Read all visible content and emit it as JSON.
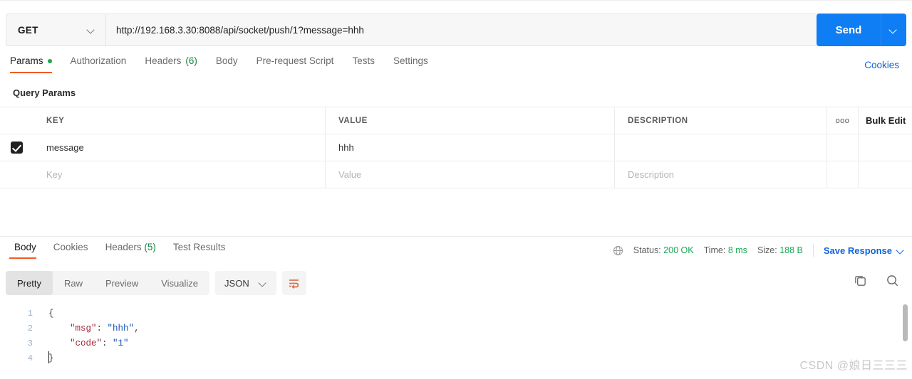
{
  "request": {
    "method": "GET",
    "url": "http://192.168.3.30:8088/api/socket/push/1?message=hhh",
    "send_label": "Send",
    "cookies_label": "Cookies",
    "tabs": [
      {
        "label": "Params",
        "dot": true,
        "active": true
      },
      {
        "label": "Authorization",
        "active": false
      },
      {
        "label": "Headers",
        "count": "(6)",
        "active": false
      },
      {
        "label": "Body",
        "active": false
      },
      {
        "label": "Pre-request Script",
        "active": false
      },
      {
        "label": "Tests",
        "active": false
      },
      {
        "label": "Settings",
        "active": false
      }
    ]
  },
  "query_params": {
    "section_title": "Query Params",
    "columns": [
      "KEY",
      "VALUE",
      "DESCRIPTION"
    ],
    "bulk_edit_label": "Bulk Edit",
    "more_icon": "ooo",
    "rows": [
      {
        "checked": true,
        "key": "message",
        "value": "hhh",
        "description": ""
      }
    ],
    "placeholder_row": {
      "key": "Key",
      "value": "Value",
      "description": "Description"
    }
  },
  "response": {
    "tabs": [
      {
        "label": "Body",
        "active": true
      },
      {
        "label": "Cookies",
        "active": false
      },
      {
        "label": "Headers",
        "count": "(5)",
        "active": false
      },
      {
        "label": "Test Results",
        "active": false
      }
    ],
    "status_label": "Status:",
    "status_value": "200 OK",
    "time_label": "Time:",
    "time_value": "8 ms",
    "size_label": "Size:",
    "size_value": "188 B",
    "save_response_label": "Save Response",
    "view_modes": [
      {
        "label": "Pretty",
        "active": true
      },
      {
        "label": "Raw",
        "active": false
      },
      {
        "label": "Preview",
        "active": false
      },
      {
        "label": "Visualize",
        "active": false
      }
    ],
    "format": "JSON",
    "body_lines": [
      {
        "n": "1",
        "tokens": [
          {
            "t": "{",
            "c": "p"
          }
        ]
      },
      {
        "n": "2",
        "tokens": [
          {
            "t": "    ",
            "c": "p"
          },
          {
            "t": "\"msg\"",
            "c": "k"
          },
          {
            "t": ": ",
            "c": "p"
          },
          {
            "t": "\"hhh\"",
            "c": "s"
          },
          {
            "t": ",",
            "c": "p"
          }
        ]
      },
      {
        "n": "3",
        "tokens": [
          {
            "t": "    ",
            "c": "p"
          },
          {
            "t": "\"code\"",
            "c": "k"
          },
          {
            "t": ": ",
            "c": "p"
          },
          {
            "t": "\"1\"",
            "c": "s"
          }
        ]
      },
      {
        "n": "4",
        "tokens": [
          {
            "t": "}",
            "c": "p"
          }
        ]
      }
    ]
  },
  "watermark": "CSDN @娘日三三三",
  "colors": {
    "accent_orange": "#ef5b25",
    "link_blue": "#0f64de",
    "send_blue": "#0f7ef4",
    "status_green": "#18a957",
    "json_key": "#a02a36",
    "json_string": "#1a54b8"
  }
}
